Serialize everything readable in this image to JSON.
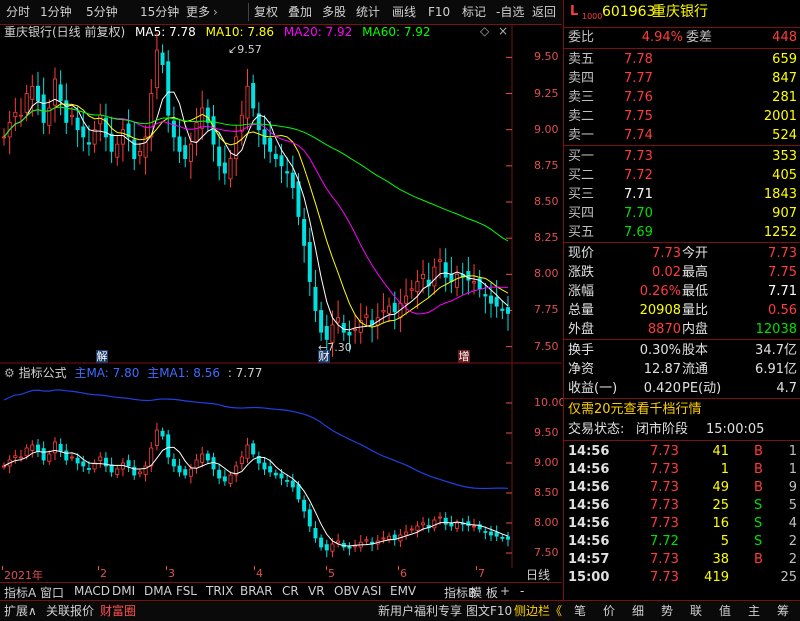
{
  "toolbar": {
    "period_tabs": [
      "分时",
      "1分钟",
      "5分钟",
      "15分钟",
      "更多"
    ],
    "more_arrow": "›",
    "right_buttons": [
      "复权",
      "叠加",
      "多股",
      "统计",
      "画线",
      "F10",
      "标记",
      "-自选",
      "返回"
    ]
  },
  "stock": {
    "prefix": "L",
    "sub": "1000",
    "code": "601963",
    "name": "重庆银行"
  },
  "main_title": {
    "name": "重庆银行(日线 前复权)",
    "ma5": "MA5: 7.78",
    "ma10": "MA10: 7.86",
    "ma20": "MA20: 7.92",
    "ma60": "MA60: 7.92",
    "icons": [
      "◇",
      "×"
    ]
  },
  "main_axis": {
    "labels": [
      "9.50",
      "9.25",
      "9.00",
      "8.75",
      "8.50",
      "8.25",
      "8.00",
      "7.75",
      "7.50"
    ],
    "ylim": [
      7.38,
      9.62
    ]
  },
  "annotations": {
    "high": "9.57",
    "low": "7.30"
  },
  "event_tags": [
    "解",
    "财",
    "增"
  ],
  "ind_title": {
    "name": "指标公式",
    "ma": "主MA: 7.80",
    "ma1": "主MA1: 8.56",
    "ma2": ": 7.77"
  },
  "ind_axis": {
    "labels": [
      "10.00",
      "9.50",
      "9.00",
      "8.50",
      "8.00",
      "7.50"
    ],
    "ylim": [
      7.25,
      10.35
    ]
  },
  "date_axis": {
    "labels": [
      "2021年",
      "2",
      "3",
      "4",
      "5",
      "6",
      "7"
    ]
  },
  "bottom_tabs": [
    "指标A",
    "窗口",
    "MACD",
    "DMI",
    "DMA",
    "FSL",
    "TRIX",
    "BRAR",
    "CR",
    "VR",
    "OBV",
    "ASI",
    "EMV",
    "指标B",
    "模 板",
    "+",
    "-",
    "日线"
  ],
  "status_bar": {
    "left": [
      "扩展∧",
      "关联报价",
      "财富圈"
    ],
    "ad": "新用户福利专享",
    "tuwen": "图文F10",
    "side": "侧边栏《",
    "right_tabs": [
      "笔",
      "价",
      "细",
      "势",
      "联",
      "值",
      "主",
      "筹"
    ]
  },
  "quote": {
    "ratio_label": "委比",
    "ratio_value": "4.94%",
    "diff_label": "委差",
    "diff_value": "448",
    "asks": [
      {
        "label": "卖五",
        "price": "7.78",
        "vol": "659"
      },
      {
        "label": "卖四",
        "price": "7.77",
        "vol": "847"
      },
      {
        "label": "卖三",
        "price": "7.76",
        "vol": "281"
      },
      {
        "label": "卖二",
        "price": "7.75",
        "vol": "2001"
      },
      {
        "label": "卖一",
        "price": "7.74",
        "vol": "524"
      }
    ],
    "bids": [
      {
        "label": "买一",
        "price": "7.73",
        "vol": "353"
      },
      {
        "label": "买二",
        "price": "7.72",
        "vol": "405"
      },
      {
        "label": "买三",
        "price": "7.71",
        "vol": "1843"
      },
      {
        "label": "买四",
        "price": "7.70",
        "vol": "907"
      },
      {
        "label": "买五",
        "price": "7.69",
        "vol": "1252"
      }
    ],
    "stats": [
      {
        "l1": "现价",
        "v1": "7.73",
        "l2": "今开",
        "v2": "7.73",
        "c1": "red",
        "c2": "red"
      },
      {
        "l1": "涨跌",
        "v1": "0.02",
        "l2": "最高",
        "v2": "7.75",
        "c1": "red",
        "c2": "red"
      },
      {
        "l1": "涨幅",
        "v1": "0.26%",
        "l2": "最低",
        "v2": "7.71",
        "c1": "red",
        "c2": "wht"
      },
      {
        "l1": "总量",
        "v1": "20908",
        "l2": "量比",
        "v2": "0.56",
        "c1": "yel",
        "c2": "red"
      },
      {
        "l1": "外盘",
        "v1": "8870",
        "l2": "内盘",
        "v2": "12038",
        "c1": "red",
        "c2": "grn"
      }
    ],
    "stats2": [
      {
        "l1": "换手",
        "v1": "0.30%",
        "l2": "股本",
        "v2": "34.7亿"
      },
      {
        "l1": "净资",
        "v1": "12.87",
        "l2": "流通",
        "v2": "6.91亿"
      },
      {
        "l1": "收益(一)",
        "v1": "0.420",
        "l2": "PE(动)",
        "v2": "4.7"
      }
    ],
    "promo": "仅需20元查看千档行情",
    "trade_state_label": "交易状态:",
    "trade_state": "闭市阶段",
    "trade_time": "15:00:05"
  },
  "ticks": [
    {
      "t": "14:56",
      "p": "7.73",
      "v": "41",
      "d": "B",
      "n": "1"
    },
    {
      "t": "14:56",
      "p": "7.73",
      "v": "1",
      "d": "B",
      "n": "1"
    },
    {
      "t": "14:56",
      "p": "7.73",
      "v": "49",
      "d": "B",
      "n": "9"
    },
    {
      "t": "14:56",
      "p": "7.73",
      "v": "25",
      "d": "S",
      "n": "5"
    },
    {
      "t": "14:56",
      "p": "7.73",
      "v": "16",
      "d": "S",
      "n": "4"
    },
    {
      "t": "14:56",
      "p": "7.72",
      "v": "5",
      "d": "S",
      "n": "2"
    },
    {
      "t": "14:57",
      "p": "7.73",
      "v": "38",
      "d": "B",
      "n": "2"
    },
    {
      "t": "15:00",
      "p": "7.73",
      "v": "419",
      "d": "",
      "n": "25"
    }
  ],
  "colors": {
    "up": "#ff3c3c",
    "down": "#00e0e0",
    "ma5": "#ffffff",
    "ma10": "#ffff00",
    "ma20": "#ff00ff",
    "ma60": "#00ff00",
    "grid": "#7a1010"
  },
  "chart_data": {
    "type": "candlestick",
    "series_note": "daily closes (front-adjusted), 2021 Jan–Jul",
    "close": [
      8.95,
      9.05,
      9.12,
      9.1,
      9.25,
      9.3,
      9.2,
      9.05,
      9.15,
      9.35,
      9.2,
      9.05,
      9.1,
      9.0,
      8.95,
      8.9,
      9.0,
      9.1,
      8.95,
      8.85,
      8.9,
      9.0,
      8.95,
      8.8,
      8.85,
      8.95,
      9.25,
      9.55,
      9.45,
      9.1,
      8.95,
      8.85,
      8.8,
      8.9,
      9.05,
      9.15,
      9.05,
      8.9,
      8.75,
      8.7,
      8.8,
      8.95,
      9.1,
      9.3,
      9.15,
      9.0,
      8.9,
      8.85,
      8.8,
      8.75,
      8.7,
      8.6,
      8.4,
      8.2,
      7.95,
      7.75,
      7.6,
      7.55,
      7.65,
      7.7,
      7.6,
      7.58,
      7.62,
      7.68,
      7.72,
      7.65,
      7.7,
      7.75,
      7.78,
      7.74,
      7.8,
      7.85,
      7.9,
      7.95,
      8.0,
      7.92,
      8.05,
      8.1,
      7.98,
      7.95,
      8.0,
      7.98,
      7.96,
      7.95,
      7.9,
      7.85,
      7.8,
      7.78,
      7.75,
      7.73
    ],
    "high_marker": 9.57,
    "low_marker": 7.3
  }
}
